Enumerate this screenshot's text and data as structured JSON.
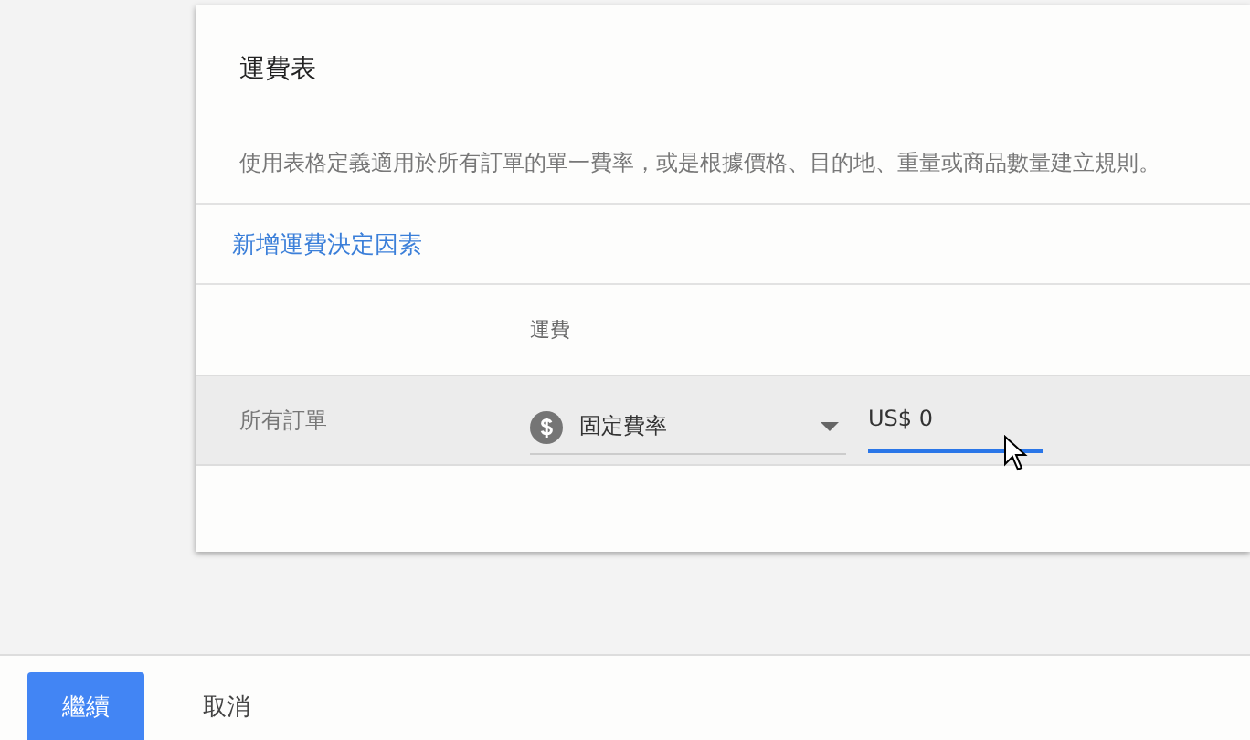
{
  "card": {
    "title": "運費表",
    "description": "使用表格定義適用於所有訂單的單一費率，或是根據價格、目的地、重量或商品數量建立規則。",
    "add_link": "新增運費決定因素",
    "table": {
      "columns": [
        "運費"
      ],
      "rows": [
        {
          "label": "所有訂單",
          "rate_type": "固定費率",
          "amount": "US$ 0",
          "amount_focused": true
        }
      ]
    }
  },
  "footer": {
    "buttons": [
      {
        "label": "繼續",
        "kind": "primary"
      },
      {
        "label": "取消",
        "kind": "text"
      }
    ]
  }
}
